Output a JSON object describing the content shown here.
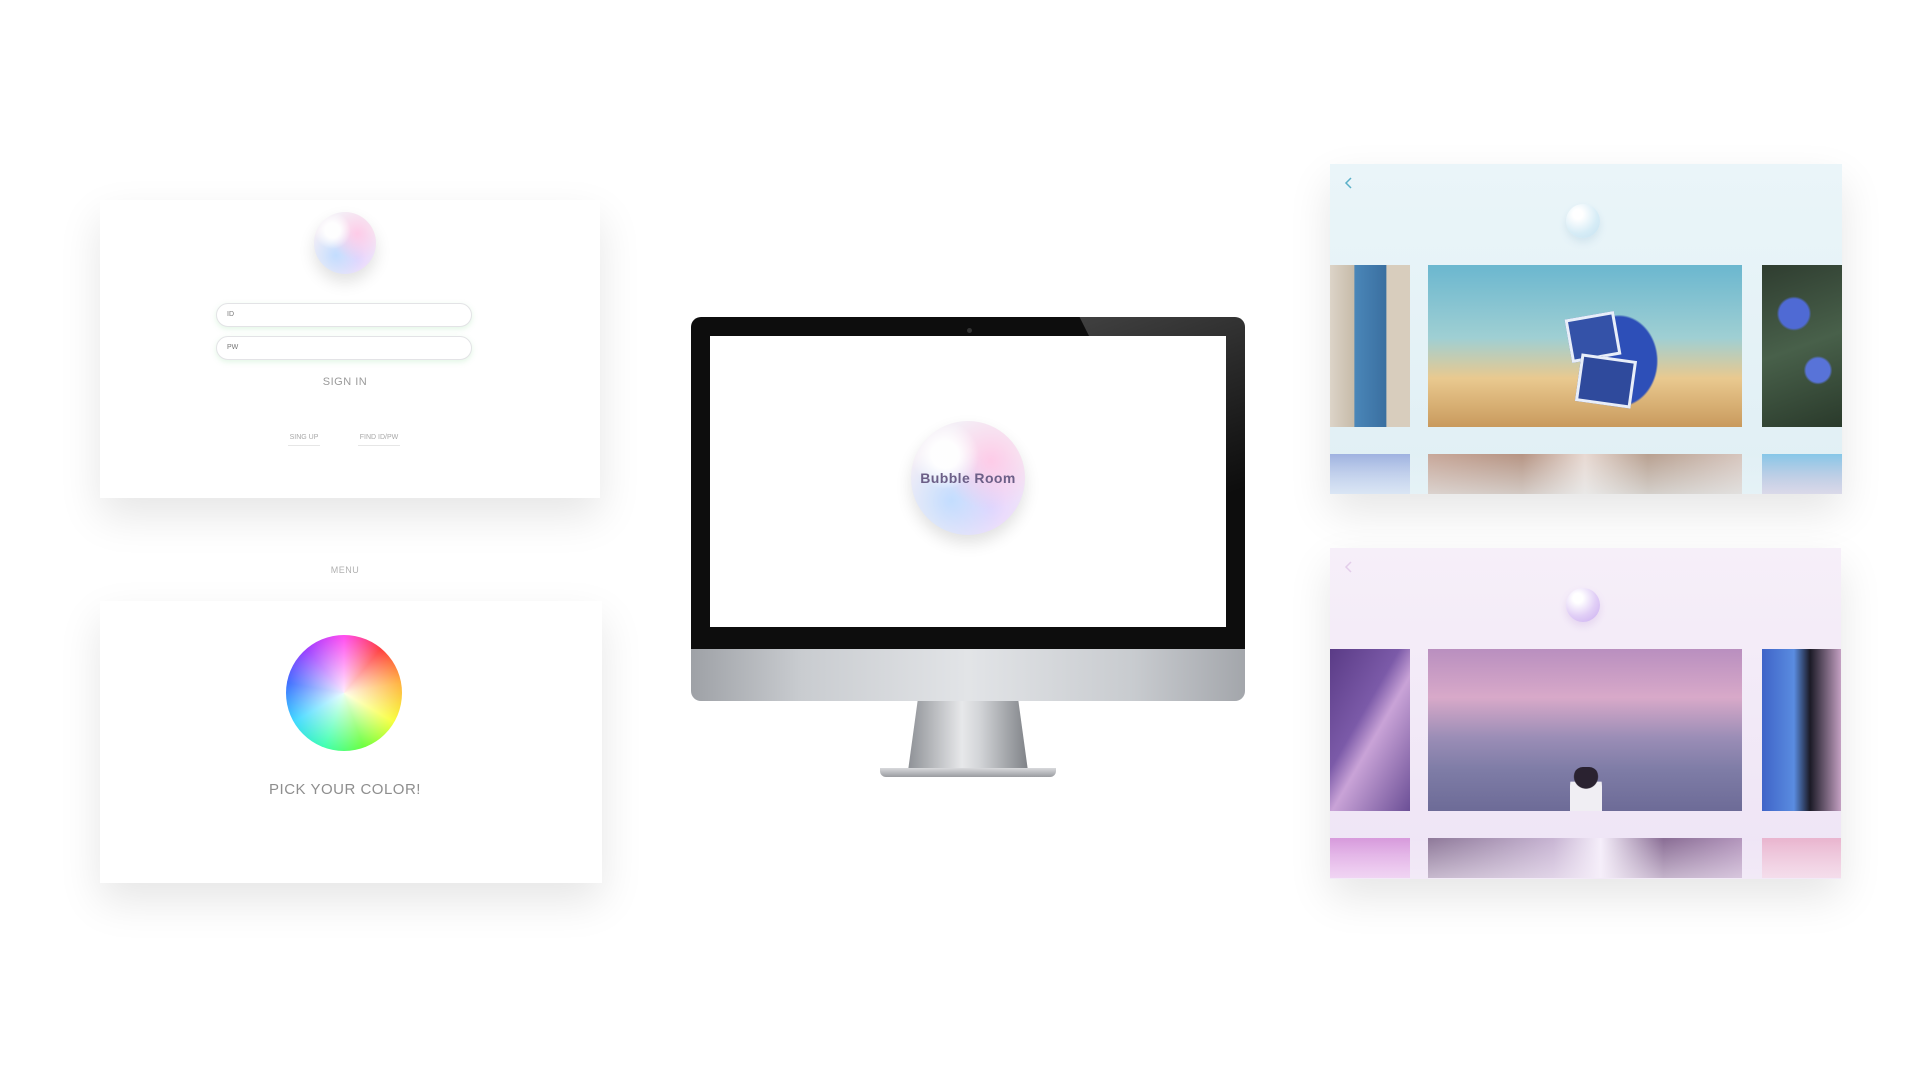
{
  "login": {
    "id_placeholder": "ID",
    "pw_placeholder": "PW",
    "sign_in_label": "SIGN IN",
    "sign_up_label": "SING UP",
    "find_label": "FIND ID/PW"
  },
  "menu": {
    "label": "MENU",
    "pick_color_label": "PICK YOUR COLOR!"
  },
  "splash": {
    "title": "Bubble Room"
  },
  "galleries": [
    {
      "theme": "blue",
      "accent": "#5ab0c8",
      "back_icon": "chevron-left-icon"
    },
    {
      "theme": "pink",
      "accent": "#c9abf0",
      "back_icon": "chevron-left-icon"
    }
  ]
}
